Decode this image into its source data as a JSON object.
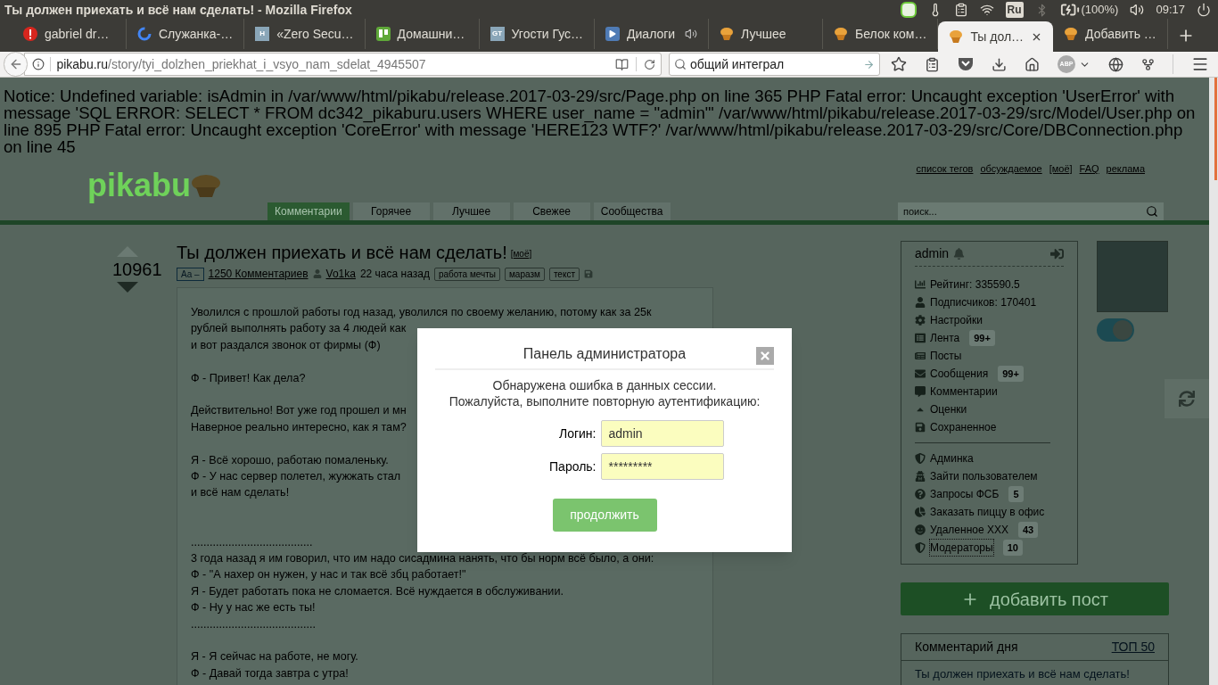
{
  "window": {
    "title": "Ты должен приехать и всё нам сделать! - Mozilla Firefox"
  },
  "tray": {
    "language": "Ru",
    "battery": "(100%)",
    "time": "09:17"
  },
  "tabs": [
    {
      "label": "gabriel dr…",
      "kind": "error",
      "audio": false,
      "selected": false
    },
    {
      "label": "Служанка-…",
      "kind": "google",
      "audio": false,
      "selected": false
    },
    {
      "label": "«Zero Secu…",
      "kind": "letter",
      "favicon_text": "H",
      "audio": false,
      "selected": false
    },
    {
      "label": "Домашни…",
      "kind": "board",
      "audio": false,
      "selected": false
    },
    {
      "label": "Угости Гус…",
      "kind": "letter",
      "favicon_text": "GT",
      "audio": false,
      "selected": false
    },
    {
      "label": "Диалоги",
      "kind": "play",
      "audio": true,
      "selected": false
    },
    {
      "label": "Лучшее",
      "kind": "muffin",
      "audio": false,
      "selected": false
    },
    {
      "label": "Белок ком…",
      "kind": "muffin",
      "audio": false,
      "selected": false
    },
    {
      "label": "Ты дол…",
      "kind": "muffin",
      "audio": false,
      "selected": true
    },
    {
      "label": "Добавить …",
      "kind": "muffin",
      "audio": false,
      "selected": false
    }
  ],
  "address": {
    "domain": "pikabu.ru",
    "path": "/story/tyi_dolzhen_priekhat_i_vsyo_nam_sdelat_4945507"
  },
  "search": {
    "value": "общий интеграл"
  },
  "adblock_badge": "ABP",
  "notice": "Notice: Undefined variable: isAdmin in /var/www/html/pikabu/release.2017-03-29/src/Page.php on line 365 PHP Fatal error: Uncaught exception 'UserError' with message 'SQL ERROR: SELECT * FROM dc342_pikaburu.users WHERE user_name = \"admin\"' /var/www/html/pikabu/release.2017-03-29/src/Model/User.php on line 895 PHP Fatal error: Uncaught exception 'CoreError' with message 'HERE123 WTF?' /var/www/html/pikabu/release.2017-03-29/src/Core/DBConnection.php on line 45",
  "site": {
    "logo": "pikabu",
    "top_links": [
      "список тегов",
      "обсуждаемое",
      "[моё]",
      "FAQ",
      "реклама"
    ],
    "nav": [
      {
        "label": "Комментарии",
        "selected": true
      },
      {
        "label": "Горячее",
        "selected": false
      },
      {
        "label": "Лучшее",
        "selected": false
      },
      {
        "label": "Свежее",
        "selected": false
      },
      {
        "label": "Сообщества",
        "selected": false
      }
    ],
    "search_placeholder": "поиск..."
  },
  "post": {
    "rating": "10961",
    "title": "Ты должен приехать и всё нам сделать!",
    "title_tag": "[моё]",
    "font_toggle": "Aa –",
    "comments": "1250 Комментариев",
    "author": "Vo1ka",
    "time": "22 часа назад",
    "tags": [
      "работа мечты",
      "маразм",
      "текст"
    ],
    "lines": [
      {
        "kind": "text",
        "text": "Уволился с прошлой работы год назад, уволился по своему желанию, потому как за 25к"
      },
      {
        "kind": "text",
        "text": "рублей выполнять работу за 4 людей как"
      },
      {
        "kind": "text",
        "text": "и вот раздался звонок от фирмы (Ф)"
      },
      {
        "kind": "blank"
      },
      {
        "kind": "text",
        "text": "Ф - Привет! Как дела?"
      },
      {
        "kind": "blank"
      },
      {
        "kind": "text",
        "text": "Действительно! Вот уже год прошел и мн"
      },
      {
        "kind": "text",
        "text": "Наверное реально интересно, как я там?"
      },
      {
        "kind": "blank"
      },
      {
        "kind": "text",
        "text": "Я - Всё хорошо, работаю помаленьку."
      },
      {
        "kind": "text",
        "text": "Ф - У нас сервер полетел, жужжать стал"
      },
      {
        "kind": "text",
        "text": "и всё нам сделать!"
      },
      {
        "kind": "blank"
      },
      {
        "kind": "blank"
      },
      {
        "kind": "text",
        "text": "......................................."
      },
      {
        "kind": "text",
        "text": "3 года назад я им говорил, что им надо сисадмина нанять, что бы норм всё было, а они:"
      },
      {
        "kind": "text",
        "text": "Ф - \"А нахер он нужен, у нас и так всё збц работает!\""
      },
      {
        "kind": "text",
        "text": "Я - Будет работать пока не сломается. Всё нуждается в обслуживании."
      },
      {
        "kind": "text",
        "text": "Ф - Ну у нас же есть ты!"
      },
      {
        "kind": "text",
        "text": "........................................"
      },
      {
        "kind": "blank"
      },
      {
        "kind": "text",
        "text": "Я - Я сейчас на работе, не могу."
      },
      {
        "kind": "text",
        "text": "Ф - Давай тогда завтра с утра!"
      }
    ]
  },
  "user_panel": {
    "name": "admin",
    "items": [
      {
        "kind": "rating",
        "label": "Рейтинг: 335590.5",
        "focused": false
      },
      {
        "kind": "subscribers",
        "label": "Подписчиков: 170401",
        "focused": false
      },
      {
        "kind": "settings",
        "label": "Настройки",
        "focused": false
      },
      {
        "kind": "feed",
        "label": "Лента",
        "badge": "99+",
        "focused": false
      },
      {
        "kind": "posts",
        "label": "Посты",
        "focused": false
      },
      {
        "kind": "messages",
        "label": "Сообщения",
        "badge": "99+",
        "focused": false
      },
      {
        "kind": "comments",
        "label": "Комментарии",
        "focused": false
      },
      {
        "kind": "votes",
        "label": "Оценки",
        "focused": false
      },
      {
        "kind": "saved",
        "label": "Сохраненное",
        "focused": false
      }
    ],
    "admin_items": [
      {
        "kind": "shield",
        "label": "Админка",
        "focused": false
      },
      {
        "kind": "impersonate",
        "label": "Зайти пользователем",
        "focused": false
      },
      {
        "kind": "question",
        "label": "Запросы ФСБ",
        "badge": "5",
        "focused": false
      },
      {
        "kind": "pie",
        "label": "Заказать пиццу в офис",
        "focused": false
      },
      {
        "kind": "smile",
        "label": "Удаленное XXX",
        "badge": "43",
        "focused": false
      },
      {
        "kind": "shield",
        "label": "Модераторы",
        "badge": "10",
        "focused": true
      }
    ],
    "toggle": {
      "on": true
    }
  },
  "add_post": "добавить пост",
  "comment_of_day": {
    "title": "Комментарий дня",
    "link": "ТОП 50",
    "text": "Ты должен приехать и всё нам сделать!"
  },
  "dialog": {
    "title": "Панель администратора",
    "message": [
      "Обнаружена ошибка в данных сессии.",
      "Пожалуйста, выполните повторную аутентификацию:"
    ],
    "fields": [
      {
        "label": "Логин:",
        "value": "admin"
      },
      {
        "label": "Пароль:",
        "value": "*********"
      }
    ],
    "button": "продолжить"
  }
}
